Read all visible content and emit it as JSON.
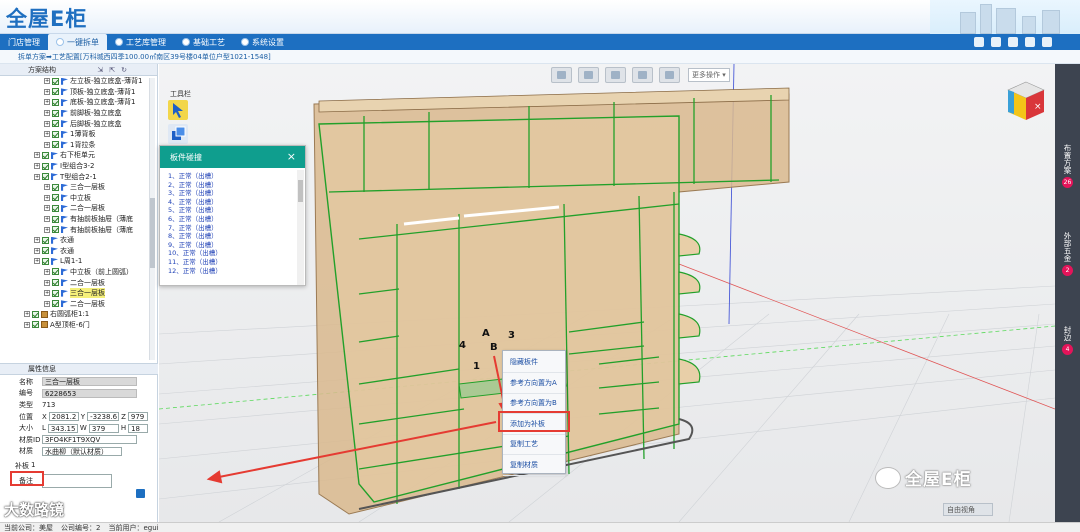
{
  "app": {
    "logo_text": "全屋E柜"
  },
  "nav": {
    "tabs": [
      {
        "label": "门店管理",
        "active": false
      },
      {
        "label": "一键拆单",
        "active": true
      },
      {
        "label": "工艺库管理",
        "active": false
      },
      {
        "label": "基础工艺",
        "active": false
      },
      {
        "label": "系统设置",
        "active": false
      }
    ]
  },
  "breadcrumb": {
    "path": "拆单方案➡工艺配置[万科城西四季100.00㎡南区39号楼04单位户型1021-1548]"
  },
  "tree_panel": {
    "title": "方案结构",
    "items": [
      {
        "label": "左立板-独立底盒-薄背1",
        "indent": 3,
        "icon": "flag",
        "selected": false
      },
      {
        "label": "顶板-独立底盒-薄背1",
        "indent": 3,
        "icon": "flag",
        "selected": false
      },
      {
        "label": "底板-独立底盒-薄背1",
        "indent": 3,
        "icon": "flag",
        "selected": false
      },
      {
        "label": "前脚板-独立底盒",
        "indent": 3,
        "icon": "flag",
        "selected": false
      },
      {
        "label": "后脚板-独立底盒",
        "indent": 3,
        "icon": "flag",
        "selected": false
      },
      {
        "label": "1薄背板",
        "indent": 3,
        "icon": "flag",
        "selected": false
      },
      {
        "label": "1背拉条",
        "indent": 3,
        "icon": "flag",
        "selected": false
      },
      {
        "label": "右下柜单元",
        "indent": 2,
        "icon": "flag",
        "selected": false
      },
      {
        "label": "I型组合3-2",
        "indent": 2,
        "icon": "flag",
        "selected": false
      },
      {
        "label": "T型组合2-1",
        "indent": 2,
        "icon": "flag",
        "selected": false
      },
      {
        "label": "三合一层板",
        "indent": 3,
        "icon": "flag",
        "selected": false
      },
      {
        "label": "中立板",
        "indent": 3,
        "icon": "flag",
        "selected": false
      },
      {
        "label": "二合一层板",
        "indent": 3,
        "icon": "flag",
        "selected": false
      },
      {
        "label": "有抽前板抽屉（薄底",
        "indent": 3,
        "icon": "flag",
        "selected": false
      },
      {
        "label": "有抽前板抽屉（薄底",
        "indent": 3,
        "icon": "flag",
        "selected": false
      },
      {
        "label": "衣通",
        "indent": 2,
        "icon": "flag",
        "selected": false
      },
      {
        "label": "衣通",
        "indent": 2,
        "icon": "flag",
        "selected": false
      },
      {
        "label": "L周1-1",
        "indent": 2,
        "icon": "flag",
        "selected": false
      },
      {
        "label": "中立板（前上圆弧）",
        "indent": 3,
        "icon": "flag",
        "selected": false
      },
      {
        "label": "二合一层板",
        "indent": 3,
        "icon": "flag",
        "selected": false
      },
      {
        "label": "三合一层板",
        "indent": 3,
        "icon": "flag",
        "selected": true
      },
      {
        "label": "二合一层板",
        "indent": 3,
        "icon": "flag",
        "selected": false
      },
      {
        "label": "右圆弧柜1:1",
        "indent": 1,
        "icon": "box",
        "selected": false
      },
      {
        "label": "A型顶柜-6门",
        "indent": 1,
        "icon": "box",
        "selected": false
      }
    ]
  },
  "props_panel": {
    "title": "属性信息",
    "name_label": "名称",
    "name_value": "三合一层板",
    "code_label": "编号",
    "code_value": "6228653",
    "type_label": "类型",
    "type_value": "713",
    "pos_label": "位置",
    "pos_x_label": "X",
    "pos_x": "2081.2",
    "pos_y_label": "Y",
    "pos_y": "-3238.6",
    "pos_z_label": "Z",
    "pos_z": "979",
    "size_label": "大小",
    "size_l_label": "L",
    "size_l": "343.15",
    "size_w_label": "W",
    "size_w": "379",
    "size_h_label": "H",
    "size_h": "18",
    "material_id_label": "材质ID",
    "material_id": "3FO4KF1T9XQV",
    "material_label": "材质",
    "material": "水曲柳（默认材质）",
    "buban_label": "补板",
    "buban_value": "1",
    "remark_label": "备注"
  },
  "status_bar": {
    "company": "当前公司：美屋",
    "company_code": "公司编号：2",
    "user": "当前用户：egui"
  },
  "toolbar": {
    "more_label": "更多操作"
  },
  "tools": {
    "title": "工具栏"
  },
  "popup": {
    "title": "板件碰撞",
    "items": [
      "1、正常（出槽）",
      "2、正常（出槽）",
      "3、正常（出槽）",
      "4、正常（出槽）",
      "5、正常（出槽）",
      "6、正常（出槽）",
      "7、正常（出槽）",
      "8、正常（出槽）",
      "9、正常（出槽）",
      "10、正常（出槽）",
      "11、正常（出槽）",
      "12、正常（出槽）"
    ]
  },
  "context_menu": {
    "items": [
      "隐藏板件",
      "参考方向置为A",
      "参考方向置为B",
      "添加为补板",
      "复制工艺",
      "复制材质"
    ],
    "highlighted_index": 3
  },
  "canvas_labels": {
    "a": "A",
    "b": "B",
    "n1": "1",
    "n3": "3",
    "n4": "4",
    "home_view": "自由视角"
  },
  "right_rail": [
    {
      "label": "布置方案",
      "count": "26"
    },
    {
      "label": "外部五金",
      "count": "2"
    },
    {
      "label": "封边",
      "count": "4"
    }
  ],
  "watermarks": {
    "right": "全屋E柜",
    "left": "大数路镜"
  },
  "colors": {
    "nav_blue": "#1d6fc1",
    "popup_teal": "#0f9e8e",
    "highlight_red": "#e53b32",
    "panel_wood": "#d8b68a",
    "edge_green": "#22a02a",
    "badge_pink": "#e4145a"
  }
}
